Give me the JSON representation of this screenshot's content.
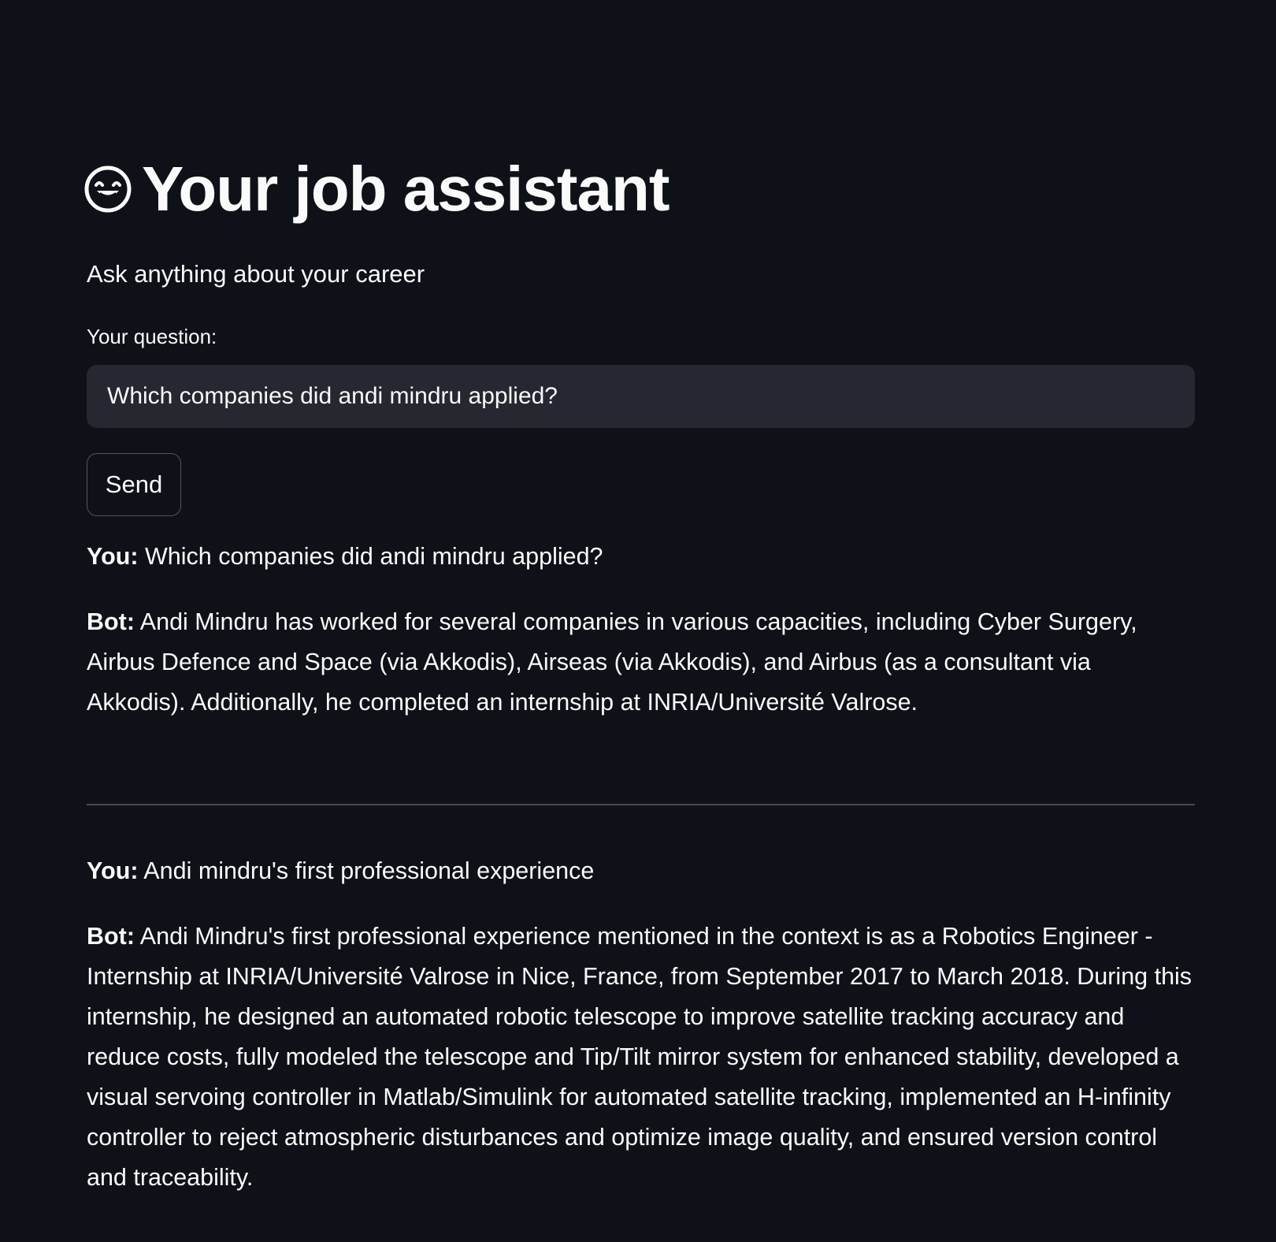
{
  "header": {
    "icon": "grinning-face-icon",
    "title": "Your job assistant",
    "subtitle": "Ask anything about your career"
  },
  "form": {
    "label": "Your question:",
    "input_value": "Which companies did andi mindru applied?",
    "send_label": "Send"
  },
  "conversation": [
    {
      "you_label": "You:",
      "question": "Which companies did andi mindru applied?",
      "bot_label": "Bot:",
      "answer": "Andi Mindru has worked for several companies in various capacities, including Cyber Surgery, Airbus Defence and Space (via Akkodis), Airseas (via Akkodis), and Airbus (as a consultant via Akkodis). Additionally, he completed an internship at INRIA/Université Valrose."
    },
    {
      "you_label": "You:",
      "question": "Andi mindru's first professional experience",
      "bot_label": "Bot:",
      "answer": "Andi Mindru's first professional experience mentioned in the context is as a Robotics Engineer - Internship at INRIA/Université Valrose in Nice, France, from September 2017 to March 2018. During this internship, he designed an automated robotic telescope to improve satellite tracking accuracy and reduce costs, fully modeled the telescope and Tip/Tilt mirror system for enhanced stability, developed a visual servoing controller in Matlab/Simulink for automated satellite tracking, implemented an H-infinity controller to reject atmospheric disturbances and optimize image quality, and ensured version control and traceability."
    }
  ],
  "colors": {
    "background": "#0e1117",
    "text": "#fafafa",
    "input_background": "#262730"
  }
}
